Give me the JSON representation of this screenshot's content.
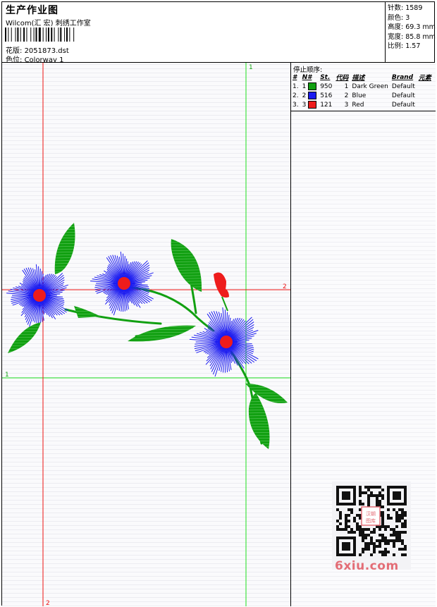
{
  "header": {
    "title": "生产作业图",
    "company": "Wilcom(汇 宏) 刺绣工作室",
    "design_label": "花版:",
    "design_value": "2051873.dst",
    "colorway_label": "色位:",
    "colorway_value": "Colorway 1"
  },
  "stats": {
    "stitches": "针数:  1589",
    "colors": "颜色:  3",
    "height": "高度:  69.3 mm",
    "width": "宽度:  85.8 mm",
    "scale": "比例:  1.57"
  },
  "panel": {
    "stop_order_label": "停止顺序:",
    "columns": [
      "#",
      "N#",
      "St.",
      "代码",
      "描述",
      "Brand",
      "元素"
    ],
    "rows": [
      {
        "idx": "1.",
        "n": "1",
        "color": "#11a011",
        "st": "950",
        "code": "1",
        "desc": "Dark Green",
        "brand": "Default"
      },
      {
        "idx": "2.",
        "n": "2",
        "color": "#1b1bf0",
        "st": "516",
        "code": "2",
        "desc": "Blue",
        "brand": "Default"
      },
      {
        "idx": "3.",
        "n": "3",
        "color": "#ee1c1c",
        "st": "121",
        "code": "3",
        "desc": "Red",
        "brand": "Default"
      }
    ]
  },
  "guides": {
    "green_v_label": "1",
    "green_h_label": "1",
    "red_v_label": "2",
    "red_h_label": "2"
  },
  "colors": {
    "guide_green": "#1ee01e",
    "guide_red": "#ee1111",
    "thread_green": "#11a011",
    "thread_blue": "#1b1bf0",
    "thread_red": "#ee1c1c",
    "watermark": "#e36d76"
  },
  "watermark": {
    "site": "6xiu.com",
    "stamp": "汉朝图库"
  }
}
